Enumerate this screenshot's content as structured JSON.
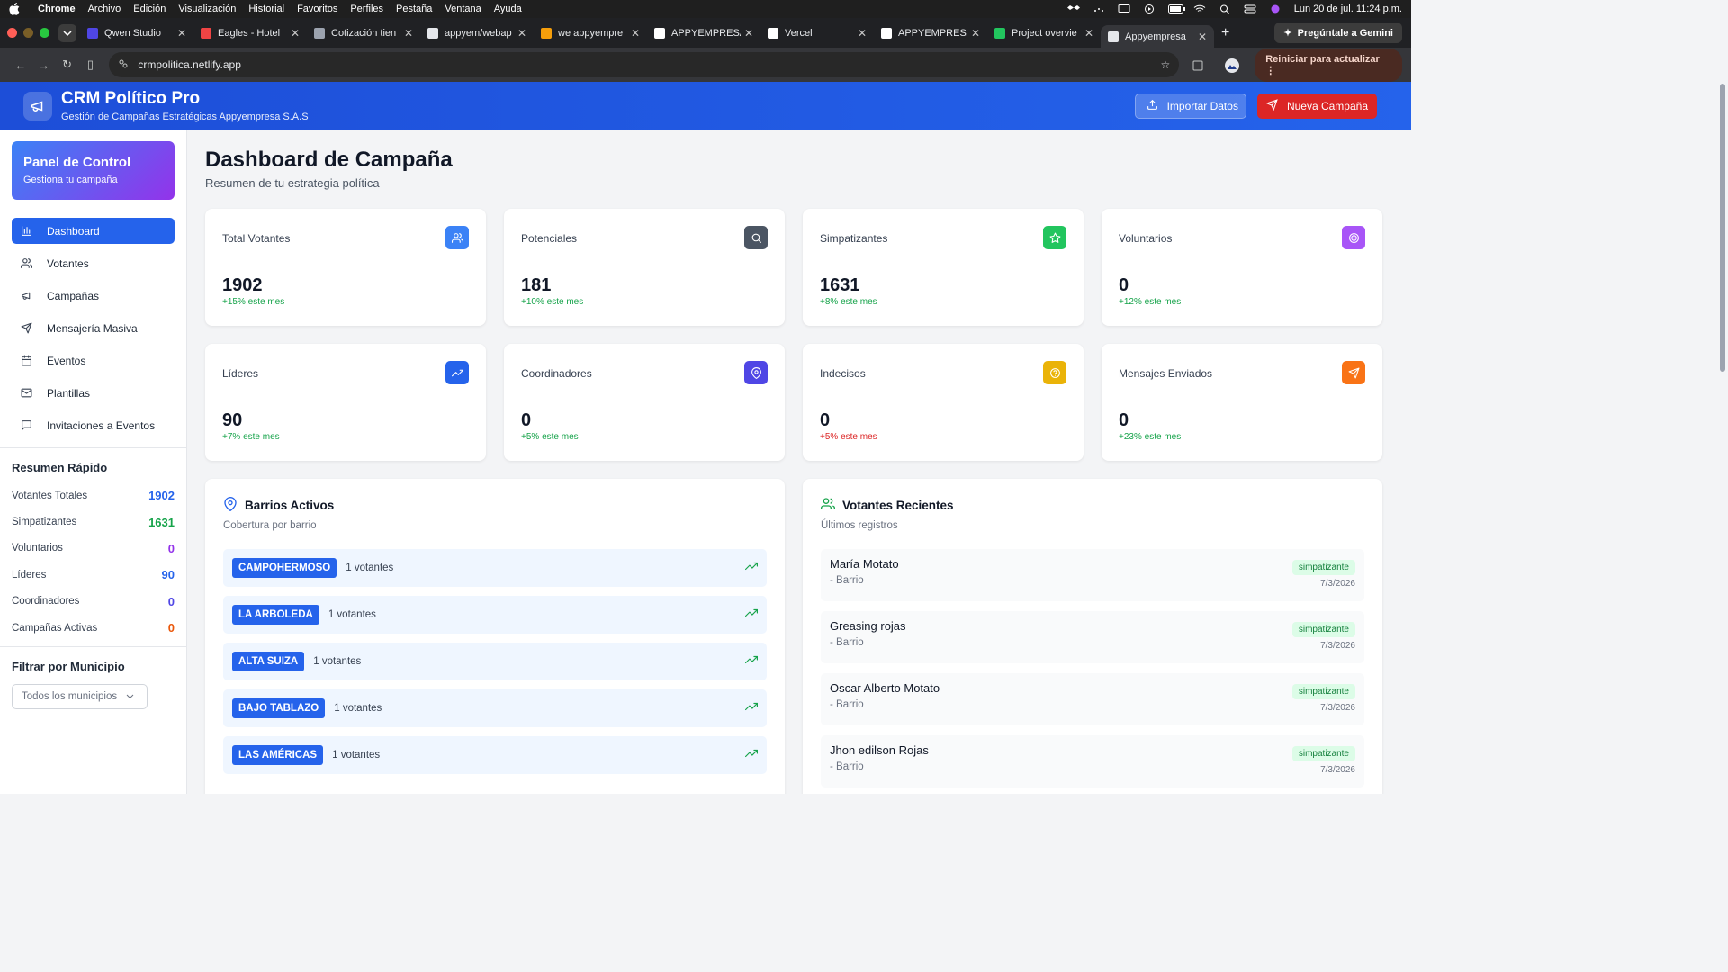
{
  "menubar": {
    "items": [
      "Chrome",
      "Archivo",
      "Edición",
      "Visualización",
      "Historial",
      "Favoritos",
      "Perfiles",
      "Pestaña",
      "Ventana",
      "Ayuda"
    ],
    "datetime": "Lun 20 de jul.  11:24 p.m."
  },
  "tabs": [
    {
      "title": "Qwen Studio",
      "color": "#4f46e5"
    },
    {
      "title": "Eagles - Hotel",
      "color": "#ef4444"
    },
    {
      "title": "Cotización tien",
      "color": "#9ca3af"
    },
    {
      "title": "appyem/webap",
      "color": "#e5e7eb"
    },
    {
      "title": "we appyempre",
      "color": "#f59e0b"
    },
    {
      "title": "APPYEMPRESA",
      "color": "#ffffff"
    },
    {
      "title": "Vercel",
      "color": "#ffffff"
    },
    {
      "title": "APPYEMPRESA",
      "color": "#ffffff"
    },
    {
      "title": "Project overvie",
      "color": "#22c55e"
    },
    {
      "title": "Appyempresa",
      "color": "#e5e7eb"
    }
  ],
  "gemini_label": "Pregúntale a Gemini",
  "address": {
    "url": "crmpolitica.netlify.app",
    "reload_label": "Reiniciar para actualizar"
  },
  "header": {
    "title": "CRM Político Pro",
    "subtitle": "Gestión de Campañas Estratégicas Appyempresa S.A.S",
    "import_label": "Importar Datos",
    "new_label": "Nueva Campaña"
  },
  "sidebar": {
    "panel_title": "Panel de Control",
    "panel_sub": "Gestiona tu campaña",
    "items": [
      {
        "label": "Dashboard",
        "icon": "bar-chart-icon"
      },
      {
        "label": "Votantes",
        "icon": "users-icon"
      },
      {
        "label": "Campañas",
        "icon": "megaphone-icon"
      },
      {
        "label": "Mensajería Masiva",
        "icon": "send-icon"
      },
      {
        "label": "Eventos",
        "icon": "calendar-icon"
      },
      {
        "label": "Plantillas",
        "icon": "mail-icon"
      },
      {
        "label": "Invitaciones a Eventos",
        "icon": "message-icon"
      }
    ],
    "summary_title": "Resumen Rápido",
    "summary": [
      {
        "label": "Votantes Totales",
        "value": "1902",
        "color": "#2563eb"
      },
      {
        "label": "Simpatizantes",
        "value": "1631",
        "color": "#16a34a"
      },
      {
        "label": "Voluntarios",
        "value": "0",
        "color": "#9333ea"
      },
      {
        "label": "Líderes",
        "value": "90",
        "color": "#2563eb"
      },
      {
        "label": "Coordinadores",
        "value": "0",
        "color": "#4f46e5"
      },
      {
        "label": "Campañas Activas",
        "value": "0",
        "color": "#ea580c"
      }
    ],
    "filter_title": "Filtrar por Municipio",
    "filter_value": "Todos los municipios"
  },
  "dashboard": {
    "title": "Dashboard de Campaña",
    "subtitle": "Resumen de tu estrategia política",
    "stats": [
      {
        "label": "Total Votantes",
        "value": "1902",
        "change": "+15% este mes",
        "change_color": "#16a34a",
        "icon_bg": "#3b82f6",
        "icon": "users-icon"
      },
      {
        "label": "Potenciales",
        "value": "181",
        "change": "+10% este mes",
        "change_color": "#16a34a",
        "icon_bg": "#4b5563",
        "icon": "search-icon"
      },
      {
        "label": "Simpatizantes",
        "value": "1631",
        "change": "+8% este mes",
        "change_color": "#16a34a",
        "icon_bg": "#22c55e",
        "icon": "star-icon"
      },
      {
        "label": "Voluntarios",
        "value": "0",
        "change": "+12% este mes",
        "change_color": "#16a34a",
        "icon_bg": "#a855f7",
        "icon": "target-icon"
      },
      {
        "label": "Líderes",
        "value": "90",
        "change": "+7% este mes",
        "change_color": "#16a34a",
        "icon_bg": "#2563eb",
        "icon": "trending-up-icon"
      },
      {
        "label": "Coordinadores",
        "value": "0",
        "change": "+5% este mes",
        "change_color": "#16a34a",
        "icon_bg": "#4f46e5",
        "icon": "map-pin-icon"
      },
      {
        "label": "Indecisos",
        "value": "0",
        "change": "+5% este mes",
        "change_color": "#dc2626",
        "icon_bg": "#eab308",
        "icon": "help-circle-icon"
      },
      {
        "label": "Mensajes Enviados",
        "value": "0",
        "change": "+23% este mes",
        "change_color": "#16a34a",
        "icon_bg": "#f97316",
        "icon": "send-icon"
      }
    ],
    "barrios": {
      "title": "Barrios Activos",
      "subtitle": "Cobertura por barrio",
      "items": [
        {
          "name": "CAMPOHERMOSO",
          "count": "1 votantes"
        },
        {
          "name": "LA ARBOLEDA",
          "count": "1 votantes"
        },
        {
          "name": "ALTA SUIZA",
          "count": "1 votantes"
        },
        {
          "name": "BAJO TABLAZO",
          "count": "1 votantes"
        },
        {
          "name": "LAS AMÉRICAS",
          "count": "1 votantes"
        }
      ]
    },
    "recientes": {
      "title": "Votantes Recientes",
      "subtitle": "Últimos registros",
      "items": [
        {
          "name": "María Motato",
          "sub": "- Barrio",
          "badge": "simpatizante",
          "date": "7/3/2026"
        },
        {
          "name": "Greasing rojas",
          "sub": "- Barrio",
          "badge": "simpatizante",
          "date": "7/3/2026"
        },
        {
          "name": "Oscar Alberto Motato",
          "sub": "- Barrio",
          "badge": "simpatizante",
          "date": "7/3/2026"
        },
        {
          "name": "Jhon edilson Rojas",
          "sub": "- Barrio",
          "badge": "simpatizante",
          "date": "7/3/2026"
        }
      ]
    }
  }
}
